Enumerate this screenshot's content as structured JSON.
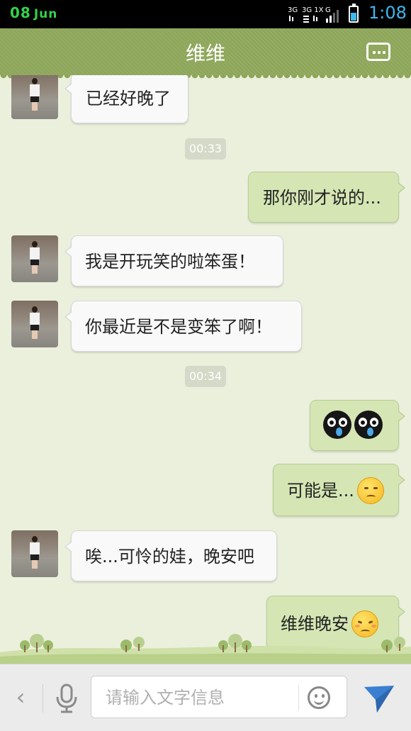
{
  "status_bar": {
    "date_day": "08",
    "date_month": "Jun",
    "network_labels": [
      "3G",
      "3G 1X",
      "G"
    ],
    "time": "1:08",
    "accent_color": "#3db8f0",
    "date_color": "#34d24a"
  },
  "header": {
    "title": "维维",
    "menu_icon": "more-options-icon",
    "background_color": "#8da659"
  },
  "messages": [
    {
      "type": "incoming",
      "text": "已经好晚了"
    },
    {
      "type": "timestamp",
      "text": "00:33"
    },
    {
      "type": "outgoing",
      "text": "那你刚才说的..."
    },
    {
      "type": "incoming",
      "text": "我是开玩笑的啦笨蛋！"
    },
    {
      "type": "incoming",
      "text": "你最近是不是变笨了啊！"
    },
    {
      "type": "timestamp",
      "text": "00:34"
    },
    {
      "type": "outgoing",
      "text": "",
      "emoji": [
        "crying-face-icon",
        "crying-face-icon"
      ]
    },
    {
      "type": "outgoing",
      "text": "可能是...",
      "emoji": [
        "worried-face-icon"
      ]
    },
    {
      "type": "incoming",
      "text": "唉...可怜的娃，晚安吧"
    },
    {
      "type": "outgoing",
      "text": "维维晚安",
      "emoji": [
        "sleepy-face-icon"
      ]
    }
  ],
  "input_bar": {
    "back_icon": "chevron-left-icon",
    "voice_icon": "microphone-icon",
    "placeholder": "请输入文字信息",
    "emoji_icon": "smiley-icon",
    "send_icon": "send-icon"
  },
  "colors": {
    "chat_background": "#eaf0dc",
    "outgoing_bubble": "#d5e6b4",
    "incoming_bubble": "#f9f9f9",
    "send_accent": "#3b7fd1"
  }
}
